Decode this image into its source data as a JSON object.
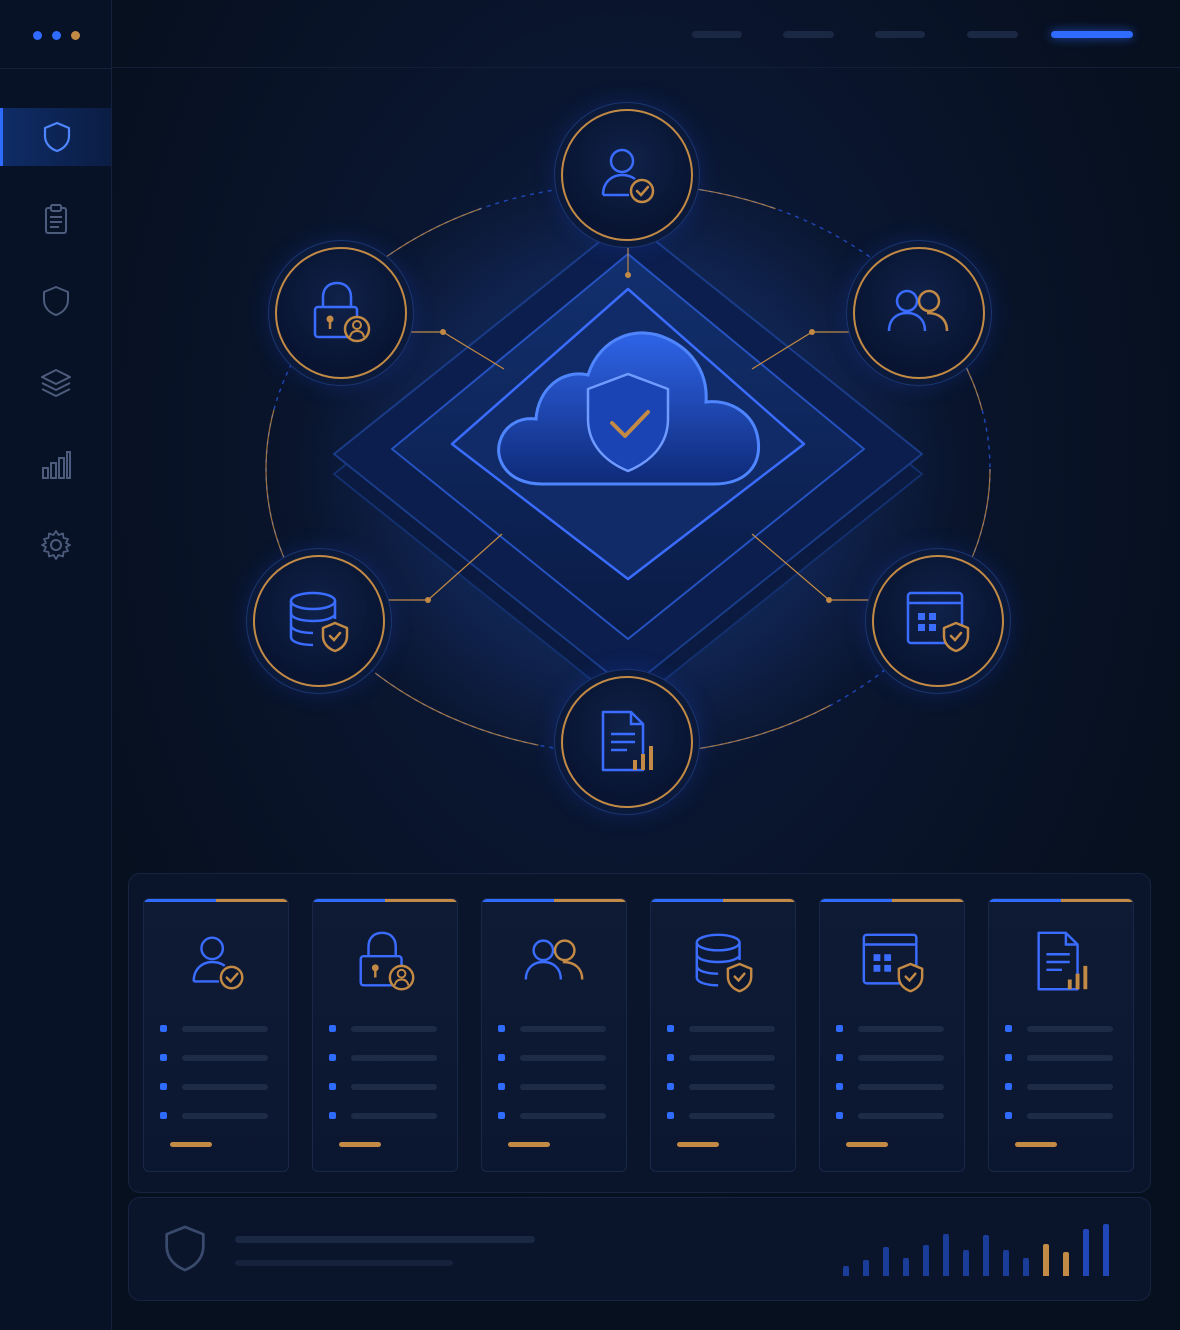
{
  "window": {
    "dot_colors": [
      "#2f6bff",
      "#2f6bff",
      "#c28a44"
    ]
  },
  "topnav": {
    "items": [
      {
        "id": "nav-1",
        "active": false
      },
      {
        "id": "nav-2",
        "active": false
      },
      {
        "id": "nav-3",
        "active": false
      },
      {
        "id": "nav-4",
        "active": false
      },
      {
        "id": "nav-5",
        "active": true
      }
    ]
  },
  "sidebar": {
    "items": [
      {
        "icon": "shield-icon",
        "active": true
      },
      {
        "icon": "clipboard-icon",
        "active": false
      },
      {
        "icon": "shield-outline-icon",
        "active": false
      },
      {
        "icon": "layers-icon",
        "active": false
      },
      {
        "icon": "bar-chart-icon",
        "active": false
      },
      {
        "icon": "gear-icon",
        "active": false
      }
    ]
  },
  "hero": {
    "center_icon": "cloud-shield-check-icon",
    "nodes": [
      {
        "icon": "user-check-icon"
      },
      {
        "icon": "users-icon"
      },
      {
        "icon": "calendar-shield-icon"
      },
      {
        "icon": "document-chart-icon"
      },
      {
        "icon": "database-shield-icon"
      },
      {
        "icon": "lock-user-icon"
      }
    ]
  },
  "cards": [
    {
      "icon": "user-check-icon",
      "rows": 4
    },
    {
      "icon": "lock-user-icon",
      "rows": 4
    },
    {
      "icon": "users-icon",
      "rows": 4
    },
    {
      "icon": "database-shield-icon",
      "rows": 4
    },
    {
      "icon": "calendar-shield-icon",
      "rows": 4
    },
    {
      "icon": "document-chart-icon",
      "rows": 4
    }
  ],
  "status": {
    "icon": "shield-outline-icon",
    "bars": [
      {
        "level": 0.2,
        "color": "#1a3d9a"
      },
      {
        "level": 0.3,
        "color": "#1a3d9a"
      },
      {
        "level": 0.55,
        "color": "#1a3d9a"
      },
      {
        "level": 0.35,
        "color": "#1a3d9a"
      },
      {
        "level": 0.6,
        "color": "#1a3d9a"
      },
      {
        "level": 0.8,
        "color": "#1a3d9a"
      },
      {
        "level": 0.5,
        "color": "#1a3d9a"
      },
      {
        "level": 0.78,
        "color": "#1a3d9a"
      },
      {
        "level": 0.5,
        "color": "#1a3d9a"
      },
      {
        "level": 0.35,
        "color": "#1a3d9a"
      },
      {
        "level": 0.62,
        "color": "#c28a44"
      },
      {
        "level": 0.46,
        "color": "#c28a44"
      },
      {
        "level": 0.9,
        "color": "#2046b8"
      },
      {
        "level": 1.0,
        "color": "#2046b8"
      }
    ]
  },
  "colors": {
    "accent_blue": "#2f6bff",
    "accent_gold": "#c28a44",
    "background": "#07101f"
  }
}
